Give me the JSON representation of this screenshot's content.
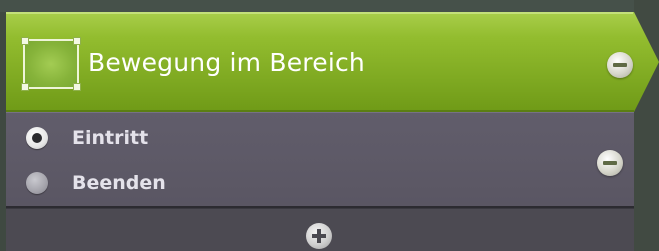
{
  "header": {
    "title": "Bewegung im Bereich",
    "icon": "area-selection-icon",
    "remove_icon": "minus-circle-icon",
    "color": "#86b126"
  },
  "options": {
    "items": [
      {
        "label": "Eintritt",
        "selected": true
      },
      {
        "label": "Beenden",
        "selected": false
      }
    ],
    "remove_icon": "minus-circle-icon",
    "color": "#5d5967"
  },
  "footer": {
    "add_icon": "plus-circle-icon"
  }
}
